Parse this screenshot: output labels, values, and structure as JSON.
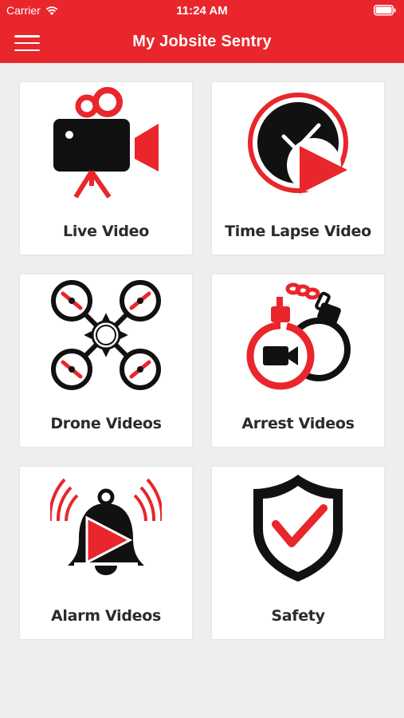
{
  "status": {
    "carrier": "Carrier",
    "time": "11:24 AM"
  },
  "header": {
    "title": "My Jobsite Sentry"
  },
  "colors": {
    "brand_red": "#e8262c",
    "icon_black": "#111111",
    "background": "#eeeeee"
  },
  "tiles": [
    {
      "label": "Live Video",
      "icon": "video-camera-icon"
    },
    {
      "label": "Time Lapse Video",
      "icon": "time-lapse-clock-icon"
    },
    {
      "label": "Drone Videos",
      "icon": "drone-icon"
    },
    {
      "label": "Arrest Videos",
      "icon": "handcuffs-icon"
    },
    {
      "label": "Alarm Videos",
      "icon": "alarm-bell-icon"
    },
    {
      "label": "Safety",
      "icon": "safety-shield-icon"
    }
  ]
}
